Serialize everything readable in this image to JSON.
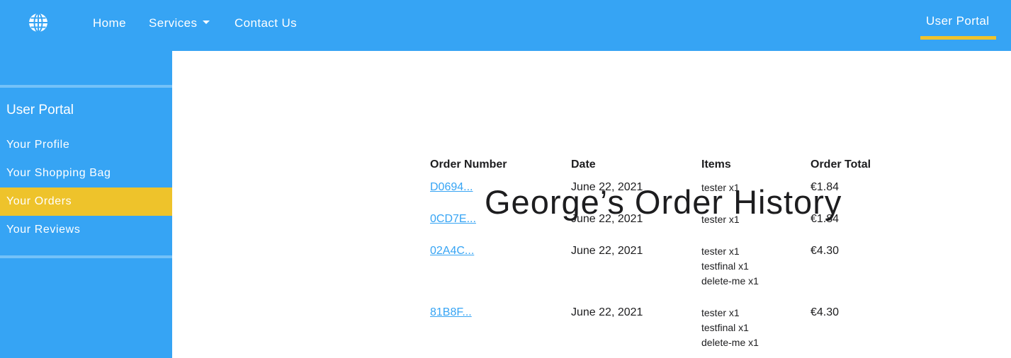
{
  "navbar": {
    "logo_icon": "globe-icon",
    "home_label": "Home",
    "services_label": "Services",
    "contact_label": "Contact Us",
    "portal_label": "User Portal",
    "background": "#36a4f4",
    "accent": "#eec32b"
  },
  "sidebar": {
    "heading": "User Portal",
    "items": [
      {
        "label": "Your Profile"
      },
      {
        "label": "Your Shopping Bag"
      },
      {
        "label": "Your Orders"
      },
      {
        "label": "Your Reviews"
      }
    ],
    "active_item": "Your Orders"
  },
  "main": {
    "title": "George’s Order History",
    "columns": [
      "Order Number",
      "Date",
      "Items",
      "Order Total"
    ],
    "rows": [
      {
        "order_number": "D0694...",
        "date": "June 22, 2021",
        "items": [
          "tester x1"
        ],
        "total": "€1.84"
      },
      {
        "order_number": "0CD7E...",
        "date": "June 22, 2021",
        "items": [
          "tester x1"
        ],
        "total": "€1.84"
      },
      {
        "order_number": "02A4C...",
        "date": "June 22, 2021",
        "items": [
          "tester x1",
          "testfinal x1",
          "delete-me x1"
        ],
        "total": "€4.30"
      },
      {
        "order_number": "81B8F...",
        "date": "June 22, 2021",
        "items": [
          "tester x1",
          "testfinal x1",
          "delete-me x1"
        ],
        "total": "€4.30"
      }
    ]
  }
}
